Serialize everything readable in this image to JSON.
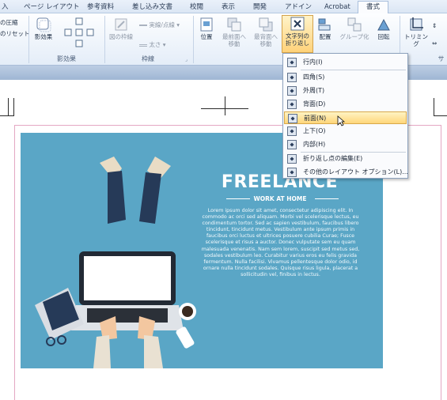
{
  "tabs": [
    "入",
    "ページ レイアウト",
    "参考資料",
    "差し込み文書",
    "校閲",
    "表示",
    "開発",
    "アドイン",
    "Acrobat",
    "書式"
  ],
  "ribbon": {
    "adjust_items": [
      "の圧縮",
      "のリセット"
    ],
    "effects_button": "影効果",
    "effects_group": "影効果",
    "frame_button": "図の枠線",
    "line_style": "実線/点線",
    "line_weight": "太さ",
    "frame_group": "枠線",
    "position_button": "位置",
    "bring_front_button": [
      "最前面へ",
      "移動"
    ],
    "send_back_button": [
      "最背面へ",
      "移動"
    ],
    "wrap_button": [
      "文字列の",
      "折り返し"
    ],
    "align_button": "配置",
    "group_button": "グループ化",
    "rotate_button": "回転",
    "trim_button": "トリミング",
    "size_group_partial": "サ"
  },
  "menu": {
    "items": [
      "行内(I)",
      "四角(S)",
      "外周(T)",
      "背面(D)",
      "前面(N)",
      "上下(O)",
      "内部(H)",
      "折り返し点の編集(E)",
      "その他のレイアウト オプション(L)..."
    ],
    "highlighted_index": 4
  },
  "poster": {
    "title": "FREELANCE",
    "subtitle": "WORK AT HOME",
    "body": "Lorem ipsum dolor sit amet, consectetur adipiscing elit. In commodo ac orci sed aliquam. Morbi vel scelerisque lectus, eu condimentum tortor. Sed ac sapien vestibulum, faucibus libero tincidunt, tincidunt metus. Vestibulum ante ipsum primis in faucibus orci luctus et ultrices posuere cubilia Curae; Fusce scelerisque et risus a auctor. Donec vulputate sem eu quam malesuada venenatis. Nam sem lorem, suscipit sed metus sed, sodales vestibulum leo. Curabitur varius eros eu felis gravida fermentum. Nulla facilisi. Vivamus pellentesque dolor odio, id ornare nulla tincidunt sodales. Quisque risus ligula, placerat a sollicitudin vel, finibus in lectus."
  },
  "colors": {
    "poster_bg": "#5aa6c6",
    "menu_highlight": "#ffd67a"
  }
}
